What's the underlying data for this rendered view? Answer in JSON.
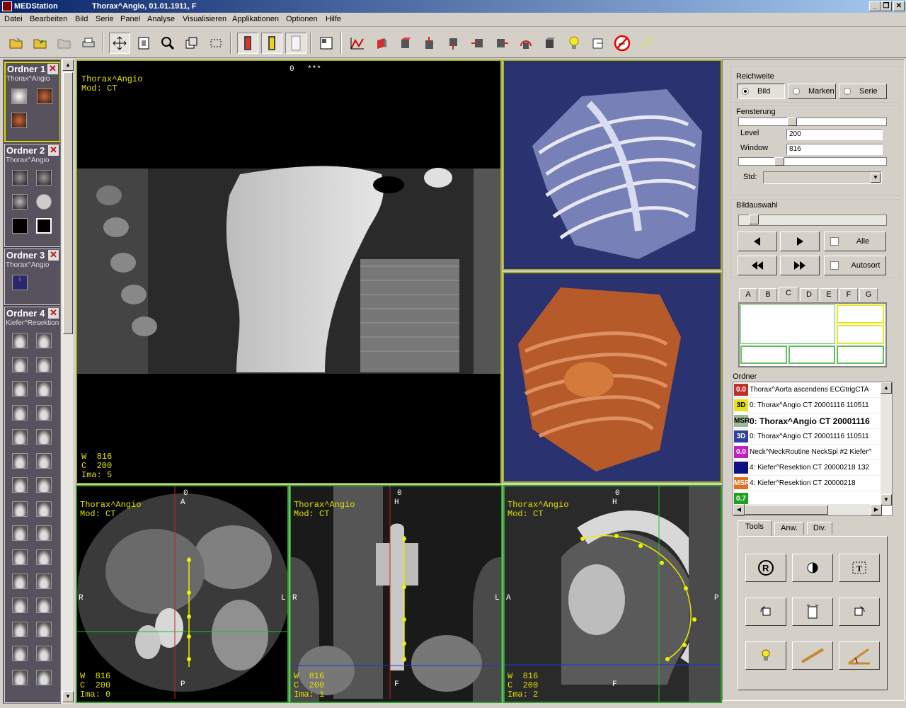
{
  "window": {
    "app_title": "MEDStation",
    "doc_title": "Thorax^Angio, 01.01.1911, F"
  },
  "menu": [
    "Datei",
    "Bearbeiten",
    "Bild",
    "Serie",
    "Panel",
    "Analyse",
    "Visualisieren",
    "Applikationen",
    "Optionen",
    "Hilfe"
  ],
  "folders": [
    {
      "title": "Ordner 1",
      "subtitle": "Thorax^Angio"
    },
    {
      "title": "Ordner 2",
      "subtitle": "Thorax^Angio"
    },
    {
      "title": "Ordner 3",
      "subtitle": "Thorax^Angio"
    },
    {
      "title": "Ordner 4",
      "subtitle": "Kiefer^Resektion"
    }
  ],
  "main_view": {
    "patient": "Thorax^Angio",
    "modality": "Mod: CT",
    "top_index": "0",
    "top_marker": "***",
    "w": "W  816",
    "c": "C  200",
    "ima": "Ima: 5"
  },
  "bottom_views": [
    {
      "patient": "Thorax^Angio",
      "modality": "Mod: CT",
      "top_label": "0",
      "top_dir": "A",
      "left_dir": "R",
      "right_dir": "L",
      "bottom_dir": "P",
      "w": "W  816",
      "c": "C  200",
      "ima": "Ima: 0"
    },
    {
      "patient": "Thorax^Angio",
      "modality": "Mod: CT",
      "top_label": "0",
      "top_dir": "H",
      "left_dir": "R",
      "right_dir": "L",
      "bottom_dir": "F",
      "w": "W  816",
      "c": "C  200",
      "ima": "Ima: 1"
    },
    {
      "patient": "Thorax^Angio",
      "modality": "Mod: CT",
      "top_label": "0",
      "top_dir": "H",
      "left_dir": "A",
      "right_dir": "P",
      "bottom_dir": "F",
      "w": "W  816",
      "c": "C  200",
      "ima": "Ima: 2"
    }
  ],
  "panel": {
    "reichweite_label": "Reichweite",
    "radio": {
      "bild": "Bild",
      "marken": "Marken",
      "serie": "Serie"
    },
    "fensterung_label": "Fensterung",
    "level_label": "Level",
    "level_value": "200",
    "window_label": "Window",
    "window_value": "816",
    "std_label": "Std:",
    "bildauswahl_label": "Bildauswahl",
    "alle_label": "Alle",
    "autosort_label": "Autosort",
    "layout_tabs": [
      "A",
      "B",
      "C",
      "D",
      "E",
      "F",
      "G"
    ],
    "ordner_label": "Ordner",
    "list": [
      {
        "icon": "0.0",
        "color": "#c0302a",
        "text": "Thorax^Aorta ascendens ECGtrigCTA"
      },
      {
        "icon": "3D",
        "color": "#e8e020",
        "text": "0: Thorax^Angio CT 20001116 110511"
      },
      {
        "icon": "MSR",
        "color": "#9ab89a",
        "text": "0: Thorax^Angio CT 20001116"
      },
      {
        "icon": "3D",
        "color": "#3040a0",
        "text": "0: Thorax^Angio CT 20001116 110511"
      },
      {
        "icon": "0.0",
        "color": "#c020c0",
        "text": "Neck^NeckRoutine NeckSpi #2 Kiefer^"
      },
      {
        "icon": "",
        "color": "#101080",
        "text": "4: Kiefer^Resektion CT 20000218 132"
      },
      {
        "icon": "MSR",
        "color": "#e07020",
        "text": "4: Kiefer^Resektion CT 20000218"
      },
      {
        "icon": "0.7",
        "color": "#20a020",
        "text": ""
      }
    ],
    "tool_tabs": [
      "Tools",
      "Anw.",
      "Div."
    ]
  }
}
